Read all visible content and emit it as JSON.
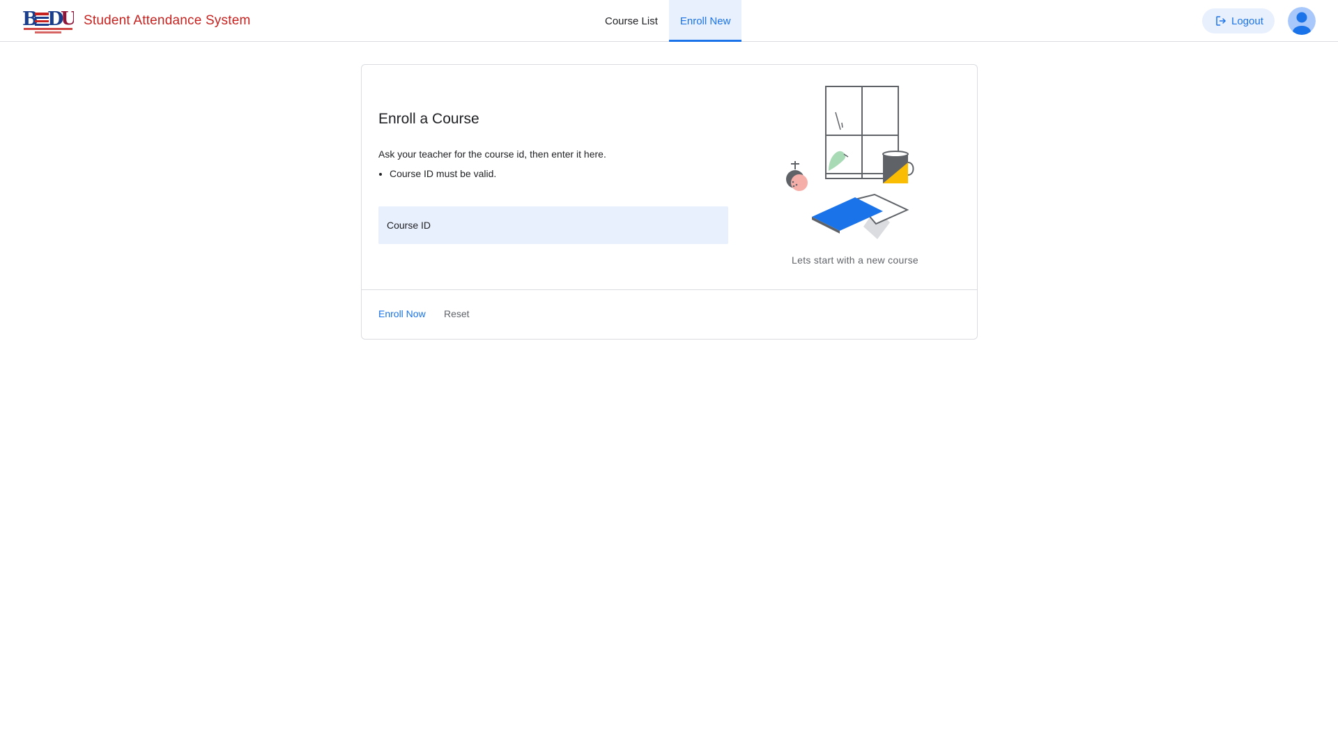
{
  "header": {
    "app_title": "Student Attendance System",
    "logo_icon": "university-logo-icon",
    "tabs": [
      {
        "label": "Course List",
        "active": false
      },
      {
        "label": "Enroll New",
        "active": true
      }
    ],
    "logout_label": "Logout",
    "logout_icon": "logout-icon",
    "avatar_icon": "account-avatar-icon"
  },
  "colors": {
    "brand_red": "#c5221f",
    "accent_blue": "#1a73e8",
    "active_tab_bg": "#e8f0fe",
    "field_bg": "#e8f0fe"
  },
  "enroll_card": {
    "title": "Enroll a Course",
    "description": "Ask your teacher for the course id, then enter it here.",
    "rules": [
      "Course ID must be valid."
    ],
    "course_id_field": {
      "label": "Course ID",
      "value": ""
    },
    "illustration": "study-desk-illustration",
    "illustration_caption": "Lets start with a new course",
    "actions": {
      "enroll_label": "Enroll Now",
      "reset_label": "Reset"
    }
  }
}
